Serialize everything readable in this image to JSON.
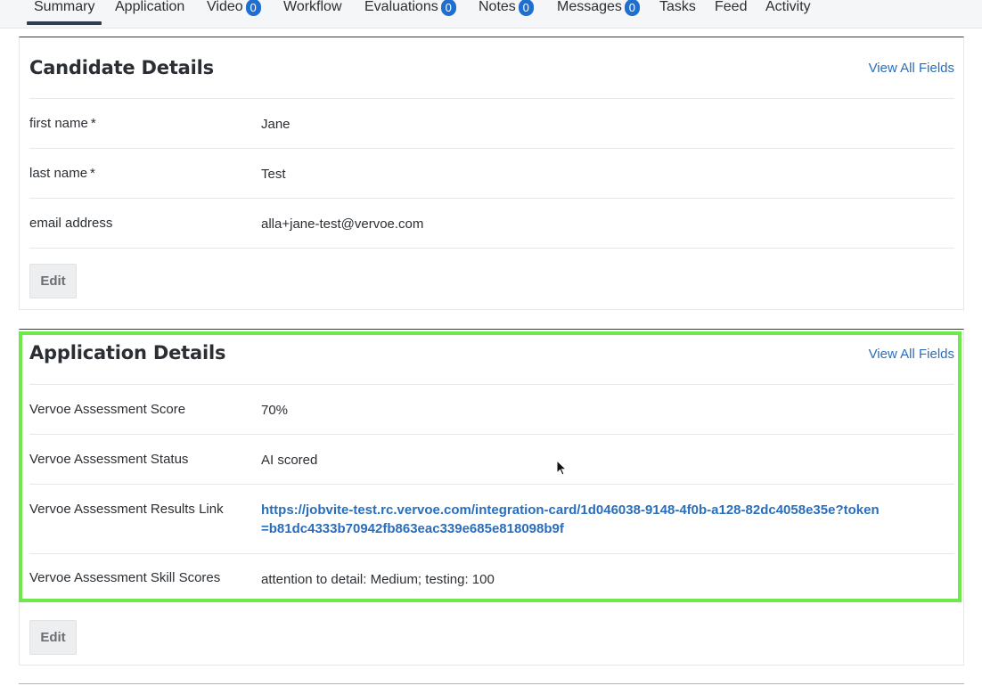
{
  "tabs": [
    {
      "label": "Summary",
      "active": true
    },
    {
      "label": "Application"
    },
    {
      "label": "Video",
      "badge": "0"
    },
    {
      "label": "Workflow"
    },
    {
      "label": "Evaluations",
      "badge": "0"
    },
    {
      "label": "Notes",
      "badge": "0"
    },
    {
      "label": "Messages",
      "badge": "0"
    },
    {
      "label": "Tasks"
    },
    {
      "label": "Feed"
    },
    {
      "label": "Activity"
    }
  ],
  "candidate": {
    "title": "Candidate Details",
    "view_all": "View All Fields",
    "rows": [
      {
        "label": "first name *",
        "value": "Jane"
      },
      {
        "label": "last name *",
        "value": "Test"
      },
      {
        "label": "email address",
        "value": "alla+jane-test@vervoe.com"
      }
    ],
    "edit_label": "Edit"
  },
  "application": {
    "title": "Application Details",
    "view_all": "View All Fields",
    "rows": [
      {
        "label": "Vervoe Assessment Score",
        "value": "70%"
      },
      {
        "label": "Vervoe Assessment Status",
        "value": "AI scored"
      },
      {
        "label": "Vervoe Assessment Results Link",
        "value": "https://jobvite-test.rc.vervoe.com/integration-card/1d046038-9148-4f0b-a128-82dc4058e35e?token=b81dc4333b70942fb863eac339e685e818098b9f"
      },
      {
        "label": "Vervoe Assessment Skill Scores",
        "value": "attention to detail: Medium; testing: 100"
      }
    ],
    "edit_label": "Edit"
  },
  "colors": {
    "accent": "#1f6fd1",
    "link": "#2a6ebb",
    "highlight": "#6ee84a"
  }
}
